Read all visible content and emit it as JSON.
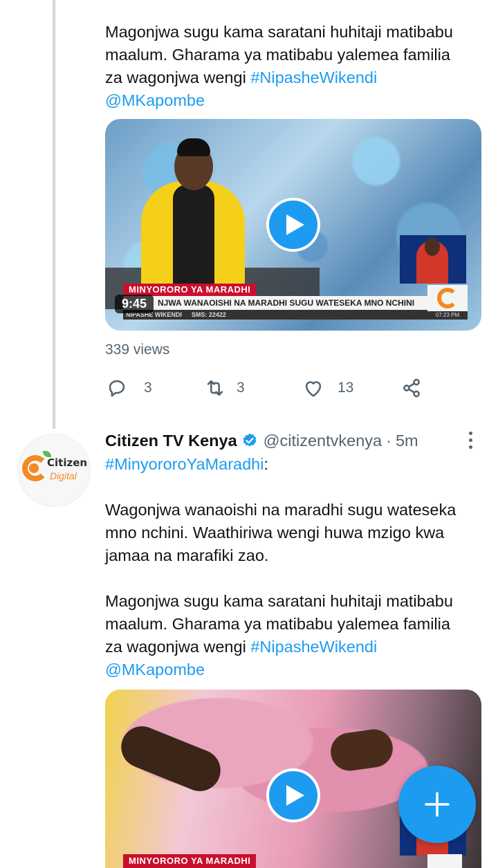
{
  "tweet1": {
    "text_line_1": "Magonjwa sugu kama saratani huhitaji matibabu",
    "text_line_2": "maalum. Gharama ya matibabu yalemea familia",
    "text_line_3_prefix": "za wagonjwa wengi ",
    "hashtag": "#NipasheWikendi",
    "mention": "@MKapombe",
    "video": {
      "banner_title": "MINYORORO YA MARADHI",
      "banner_caption": "NJWA WANAOISHI NA MARADHI SUGU WATESEKA MNO NCHINI",
      "banner_show": "NIPASHE WIKENDI",
      "banner_sms": "SMS: 22422",
      "clock": "07:23 PM",
      "duration": "9:45"
    },
    "views": "339 views",
    "replies": "3",
    "retweets": "3",
    "likes": "13"
  },
  "tweet2": {
    "author_name": "Citizen TV Kenya",
    "handle": "@citizentvkenya",
    "separator": "·",
    "time": "5m",
    "avatar_text_1": "Citizen",
    "avatar_text_2": "Digital",
    "hashtag_top": "#MinyororoYaMaradhi",
    "colon": ":",
    "para1": "Wagonjwa wanaoishi na maradhi sugu wateseka mno nchini. Waathiriwa wengi huwa mzigo kwa jamaa na marafiki zao.",
    "text_line_1": "Magonjwa sugu kama saratani huhitaji matibabu",
    "text_line_2": "maalum. Gharama ya matibabu yalemea familia",
    "text_line_3_prefix": "za wagonjwa wengi ",
    "hashtag": "#NipasheWikendi",
    "mention": "@MKapombe",
    "video": {
      "banner_title": "MINYORORO YA MARADHI"
    }
  },
  "colors": {
    "accent": "#1d9bf0",
    "text": "#0f1419",
    "secondary": "#536471",
    "thread_line": "#cfd9de",
    "banner_red": "#c8102e",
    "brand_orange": "#f28a22"
  },
  "icons": {
    "reply": "reply-icon",
    "retweet": "retweet-icon",
    "like": "heart-icon",
    "share": "share-icon",
    "verified": "verified-badge-icon",
    "more": "more-icon",
    "play": "play-icon",
    "compose": "plus-icon"
  }
}
